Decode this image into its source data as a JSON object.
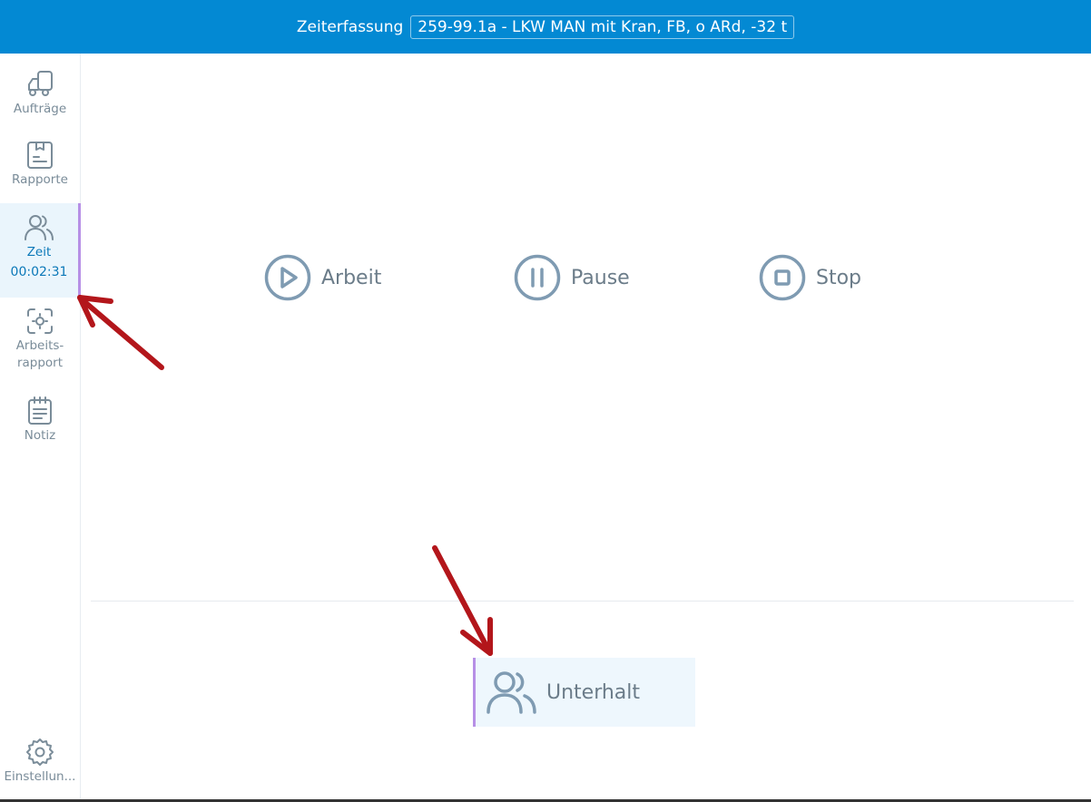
{
  "header": {
    "title": "Zeiterfassung",
    "vehicle": "259-99.1a - LKW MAN mit Kran, FB, o ARd, -32 t"
  },
  "sidebar": {
    "items": [
      {
        "label": "Aufträge",
        "icon": "truck-icon"
      },
      {
        "label": "Rapporte",
        "icon": "report-icon"
      },
      {
        "label": "Zeit",
        "icon": "users-icon",
        "timer": "00:02:31",
        "active": true
      },
      {
        "label": "Arbeits-",
        "label2": "rapport",
        "icon": "scan-icon"
      },
      {
        "label": "Notiz",
        "icon": "notepad-icon"
      }
    ],
    "settings": {
      "label": "Einstellun...",
      "icon": "gear-icon"
    }
  },
  "actions": [
    {
      "label": "Arbeit",
      "icon": "play-icon"
    },
    {
      "label": "Pause",
      "icon": "pause-icon"
    },
    {
      "label": "Stop",
      "icon": "stop-icon"
    }
  ],
  "category": {
    "label": "Unterhalt",
    "icon": "users-icon"
  },
  "colors": {
    "header": "#0389d3",
    "active_bg": "#eaf5fc",
    "accent_border": "#b790e6",
    "icon": "#7a8c99",
    "annotation_arrow": "#b3161b"
  }
}
